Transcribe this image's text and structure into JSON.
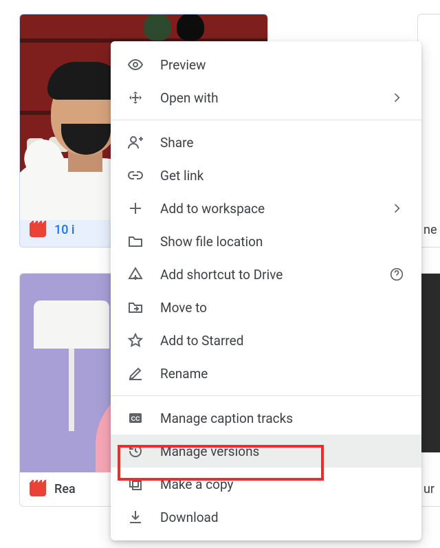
{
  "cards": {
    "card1": {
      "title": "10 i"
    },
    "card2": {
      "title": "Rea"
    },
    "peek1": {
      "title": "ne"
    },
    "peek2": {
      "title": "ur"
    }
  },
  "menu": {
    "preview": "Preview",
    "open_with": "Open with",
    "share": "Share",
    "get_link": "Get link",
    "add_workspace": "Add to workspace",
    "show_location": "Show file location",
    "add_shortcut": "Add shortcut to Drive",
    "move_to": "Move to",
    "add_starred": "Add to Starred",
    "rename": "Rename",
    "manage_captions": "Manage caption tracks",
    "manage_versions": "Manage versions",
    "make_copy": "Make a copy",
    "download": "Download"
  }
}
